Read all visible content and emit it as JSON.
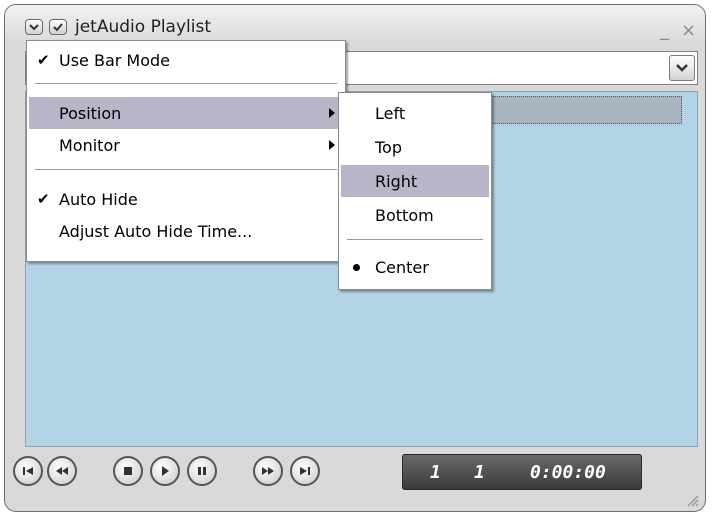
{
  "window": {
    "title": "jetAudio Playlist",
    "minimize_glyph": "_",
    "close_glyph": "×",
    "title_icons": [
      "dropdown-icon",
      "check-icon"
    ]
  },
  "combo": {
    "value": "",
    "icon": "chevron-down-icon"
  },
  "context_menu": {
    "items": [
      {
        "label": "Use Bar Mode",
        "checked": true
      },
      {
        "label": "Position",
        "submenu": true,
        "highlighted": true
      },
      {
        "label": "Monitor",
        "submenu": true
      },
      {
        "label": "Auto Hide",
        "checked": true
      },
      {
        "label": "Adjust Auto Hide Time..."
      }
    ],
    "check_glyph": "✔"
  },
  "position_submenu": {
    "items": [
      {
        "label": "Left"
      },
      {
        "label": "Top"
      },
      {
        "label": "Right",
        "highlighted": true
      },
      {
        "label": "Bottom"
      },
      {
        "label": "Center",
        "selected": true
      }
    ]
  },
  "player": {
    "buttons": [
      "skip-to-start-icon",
      "rewind-icon",
      "stop-icon",
      "play-icon",
      "pause-icon",
      "fast-forward-icon",
      "skip-to-end-icon"
    ],
    "display": {
      "track": "1",
      "total": "1",
      "time": "0:00:00"
    }
  },
  "colors": {
    "list_background": "#b3d3e6",
    "menu_highlight": "#b8b5c8",
    "display_background": "#4a4a4a"
  }
}
